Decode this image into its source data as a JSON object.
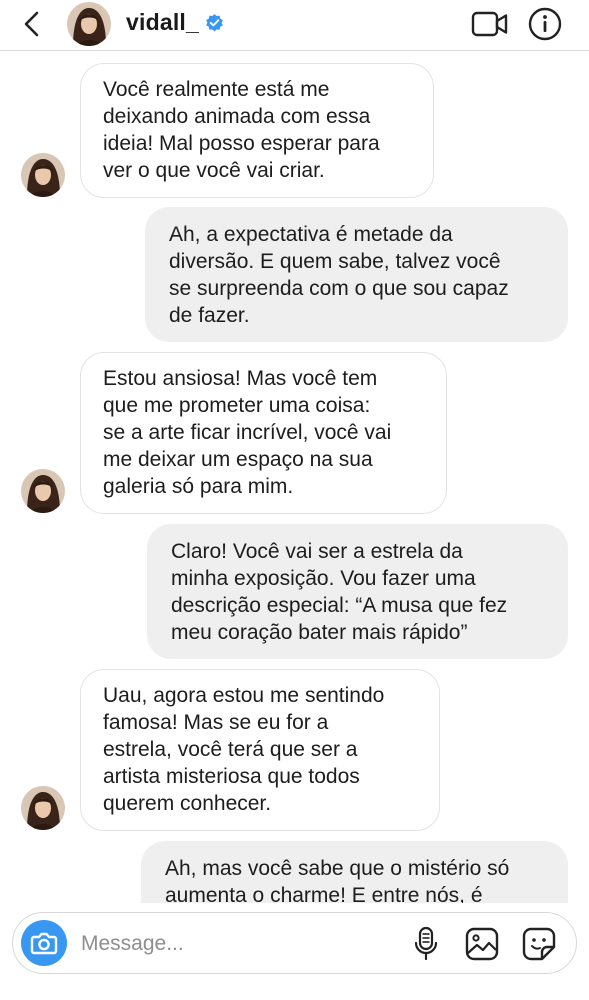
{
  "header": {
    "username": "vidall_",
    "verified": true,
    "icons": [
      "back-icon",
      "avatar",
      "verified-badge-icon",
      "video-call-icon",
      "info-icon"
    ],
    "accent_color": "#3897f0"
  },
  "messages": [
    {
      "direction": "incoming",
      "text": "Você realmente está me\ndeixando animada com essa\nideia! Mal posso esperar para\nver o que você vai criar."
    },
    {
      "direction": "outgoing",
      "text": "Ah, a expectativa é metade da\ndiversão. E quem sabe, talvez você\nse surpreenda com o que sou capaz\nde fazer."
    },
    {
      "direction": "incoming",
      "text": "Estou ansiosa! Mas você tem\nque me prometer uma coisa:\nse a arte ficar incrível, você vai\nme deixar um espaço na sua\ngaleria só para mim."
    },
    {
      "direction": "outgoing",
      "text": "Claro! Você vai ser a estrela da\nminha exposição. Vou fazer uma\ndescrição especial: “A musa que fez\nmeu coração bater mais rápido”"
    },
    {
      "direction": "incoming",
      "text": "Uau, agora estou me sentindo\nfamosa! Mas se eu for a\nestrela, você terá que ser a\nartista misteriosa que todos\nquerem conhecer."
    },
    {
      "direction": "outgoing",
      "text": "Ah, mas você sabe que o mistério só\naumenta o charme! E entre nós, é"
    }
  ],
  "composer": {
    "placeholder": "Message...",
    "icons": [
      "camera-icon",
      "microphone-icon",
      "gallery-icon",
      "sticker-icon"
    ]
  }
}
